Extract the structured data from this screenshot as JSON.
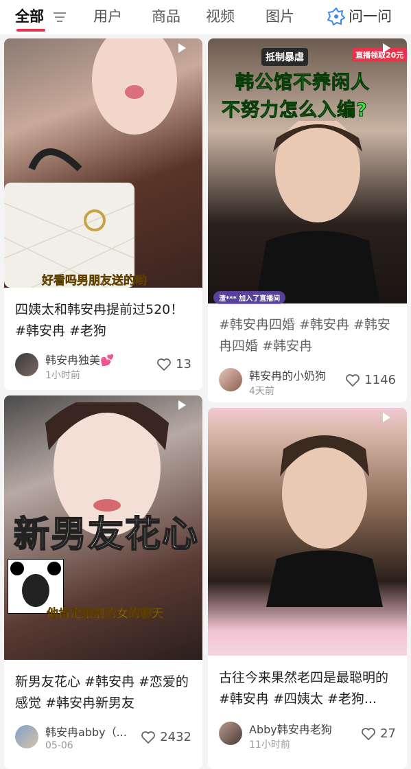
{
  "tabs": [
    {
      "label": "全部",
      "active": true
    },
    {
      "label": "用户"
    },
    {
      "label": "商品"
    },
    {
      "label": "视频"
    },
    {
      "label": "图片"
    },
    {
      "label": "问一问"
    }
  ],
  "colors": {
    "accent": "#e8334a",
    "ask_icon": "#3b8cf0"
  },
  "cards": [
    {
      "title": "四姨太和韩安冉提前过520！ #韩安冉 #老狗",
      "cover_caption": "好看吗男朋友送的哟",
      "author": "韩安冉独美💕",
      "time": "1小时前",
      "likes": "13",
      "icon": "play-icon"
    },
    {
      "title": "#韩安冉四婚 #韩安冉 #韩安冉四婚 #韩安冉",
      "cover_line1": "韩公馆不养闲人",
      "cover_line2": "不努力怎么入编?",
      "cover_sticker": "抵制暴虐",
      "cover_badge": "直播领取20元",
      "cover_comment": "渣***  加入了直播间",
      "author": "韩安冉的小奶狗",
      "time": "4天前",
      "likes": "1146",
      "icon": "play-icon"
    },
    {
      "title": "新男友花心 #韩安冉 #恋爱的感觉 #韩安冉新男友",
      "cover_big": "新男友花心",
      "cover_caption": "他肯定跟别的女的聊天",
      "author": "韩安冉abby（...",
      "time": "05-06",
      "likes": "2432",
      "icon": "play-icon"
    },
    {
      "title": "古往今来果然老四是最聪明的#韩安冉 #四姨太 #老狗...",
      "author": "Abby韩安冉老狗",
      "time": "11小时前",
      "likes": "27",
      "icon": "play-icon"
    }
  ]
}
